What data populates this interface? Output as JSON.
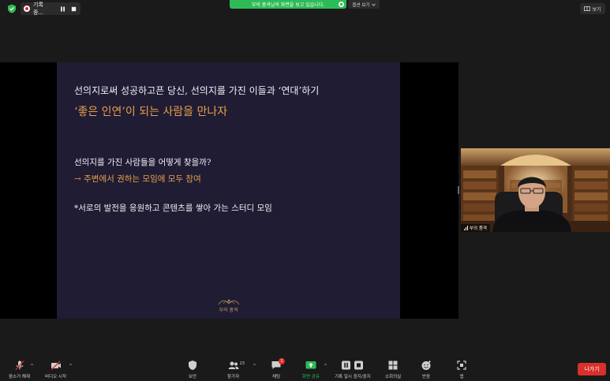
{
  "topbar": {
    "recording_label": "기록 중...",
    "share_banner": "부의 품격님의 화면을 보고 있습니다.",
    "view_options": "옵션 보기",
    "view_button": "보기"
  },
  "slide": {
    "line1": "선의지로써 성공하고픈 당신, 선의지를 가진 이들과 ‘연대’하기",
    "line2": "‘좋은 인연’이 되는 사람을 만나자",
    "line3": "선의지를 가진 사람들을 어떻게 찾을까?",
    "line4": "→ 주변에서 권하는 모임에 모두 참여",
    "line5": "*서로의 발전을 응원하고 콘텐츠를 쌓아 가는 스터디 모임",
    "logo_text": "부의 품격",
    "accent_color": "#e8a04c",
    "background_color": "#201c34"
  },
  "video": {
    "participant_name": "부의 품격"
  },
  "toolbar": {
    "mute_label": "음소거 해제",
    "video_label": "비디오 시작",
    "security_label": "보안",
    "participants_label": "참가자",
    "participants_count": "23",
    "chat_label": "채팅",
    "chat_badge": "1",
    "share_label": "화면 공유",
    "record_label": "기록 일시 중지/중지",
    "breakout_label": "소회의실",
    "reactions_label": "반응",
    "apps_label": "앱",
    "leave_label": "나가기",
    "share_color": "#2dbb57",
    "leave_color": "#d9302c"
  }
}
